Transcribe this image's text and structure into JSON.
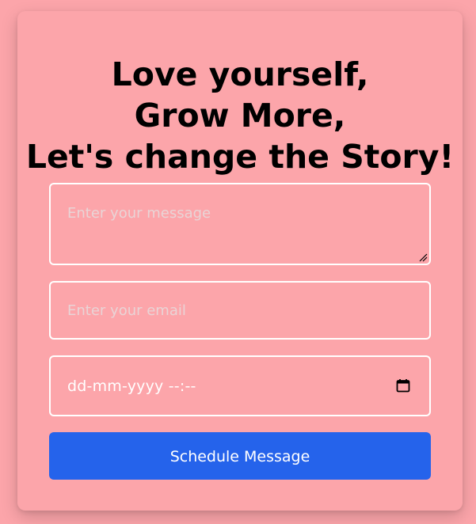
{
  "card": {
    "title_lines": [
      "Love yourself,",
      "Grow More,",
      "Let's change the Story!"
    ]
  },
  "form": {
    "message": {
      "placeholder": "Enter your message",
      "value": ""
    },
    "email": {
      "placeholder": "Enter your email",
      "value": ""
    },
    "datetime": {
      "display": "dd-mm-yyyy --:--",
      "icon": "calendar-icon"
    },
    "submit_label": "Schedule Message"
  },
  "colors": {
    "background": "#fca5aa",
    "button": "#2563eb",
    "field_border": "#ffffff",
    "placeholder": "#e9d4d6"
  }
}
